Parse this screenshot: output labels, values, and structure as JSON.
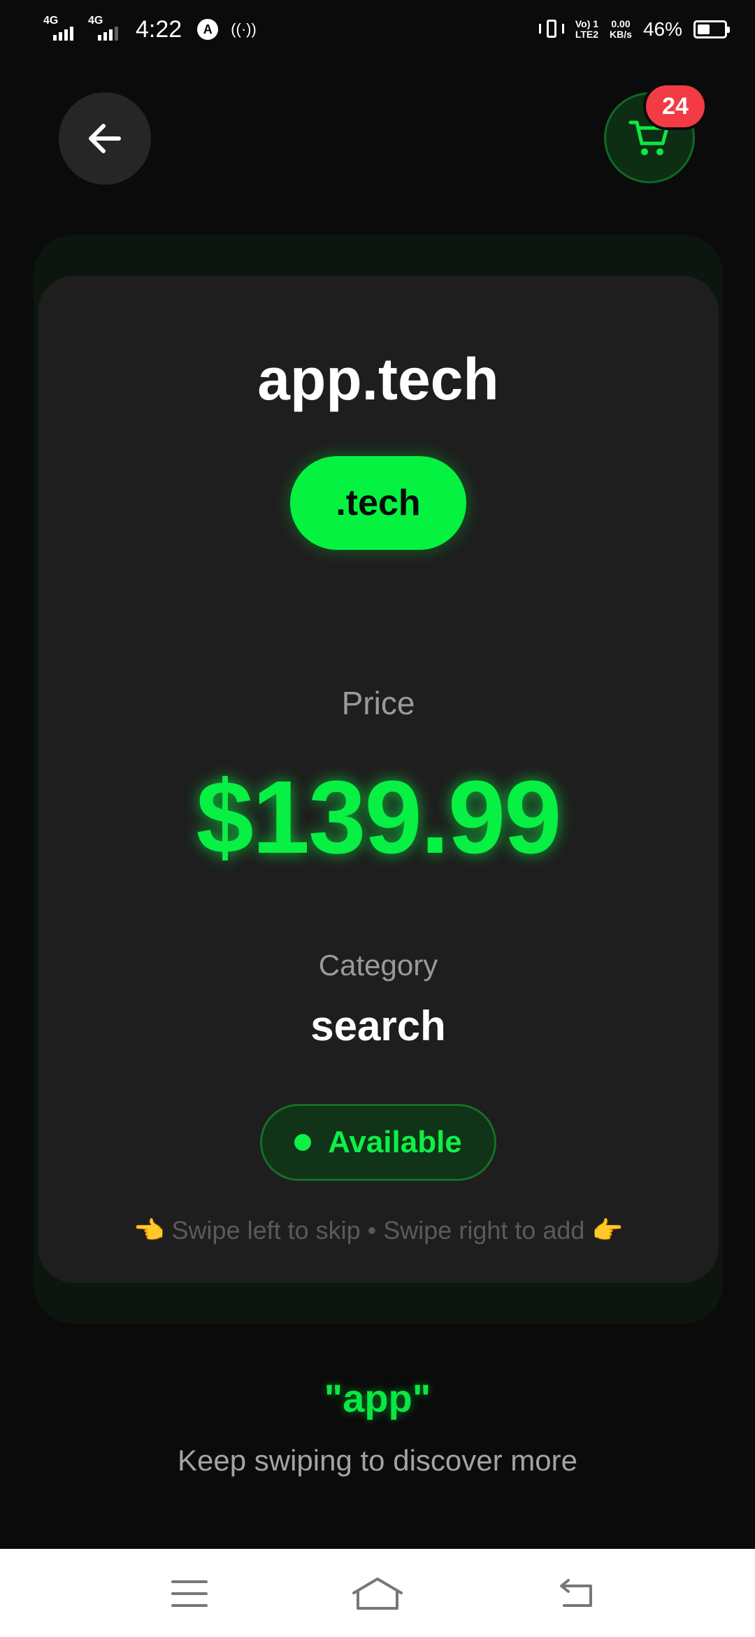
{
  "status_bar": {
    "network_1": "4G",
    "network_2": "4G",
    "time": "4:22",
    "notification_icon": "A",
    "hotspot": "((·))",
    "volte_top": "Vo) 1",
    "volte_bottom": "LTE2",
    "speed_top": "0.00",
    "speed_bottom": "KB/s",
    "battery_percent": "46%",
    "battery_level": 0.46
  },
  "header": {
    "back_icon": "arrow-left-icon",
    "cart_icon": "cart-icon",
    "cart_count": "24"
  },
  "card": {
    "domain": "app.tech",
    "tld": ".tech",
    "price_label": "Price",
    "price": "$139.99",
    "category_label": "Category",
    "category": "search",
    "status": "Available",
    "swipe_hint_left_icon": "👈",
    "swipe_hint": "Swipe left to skip • Swipe right to add",
    "swipe_hint_right_icon": "👉"
  },
  "footer": {
    "query": "\"app\"",
    "hint": "Keep swiping to discover more"
  },
  "nav": {
    "menu_icon": "menu-icon",
    "home_icon": "home-icon",
    "back_icon": "back-nav-icon"
  },
  "colors": {
    "background": "#0b0b0b",
    "card": "#1e1e1e",
    "accent_green": "#06f240",
    "badge_red": "#f23b44"
  }
}
